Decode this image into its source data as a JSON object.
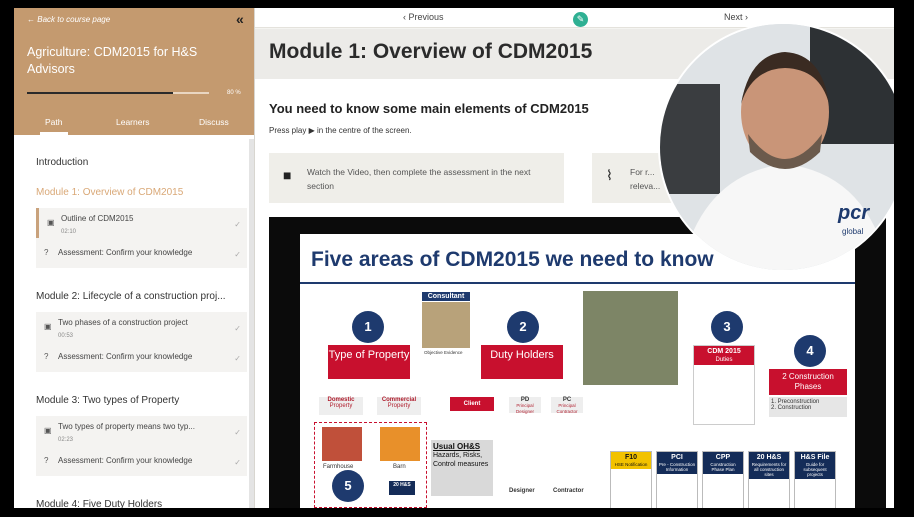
{
  "sidebar": {
    "back_label": "Back to course page",
    "collapse_icon": "double-chevron-left-icon",
    "course_title": "Agriculture: CDM2015 for H&S Advisors",
    "progress_pct": 80,
    "progress_label": "80 %",
    "tabs": [
      "Path",
      "Learners",
      "Discuss"
    ],
    "active_tab": "Path",
    "intro_label": "Introduction",
    "modules": [
      {
        "title": "Module 1: Overview of CDM2015",
        "current": true,
        "lessons": [
          {
            "icon": "video-icon",
            "title": "Outline of CDM2015",
            "duration": "02:10",
            "check": "✓",
            "active": true
          },
          {
            "icon": "question-icon",
            "title": "Assessment: Confirm your knowledge",
            "duration": "",
            "check": "✓",
            "active": false
          }
        ]
      },
      {
        "title": "Module 2: Lifecycle of a construction proj...",
        "current": false,
        "lessons": [
          {
            "icon": "video-icon",
            "title": "Two phases of a construction project",
            "duration": "00:53",
            "check": "✓",
            "active": false
          },
          {
            "icon": "question-icon",
            "title": "Assessment: Confirm your knowledge",
            "duration": "",
            "check": "✓",
            "active": false
          }
        ]
      },
      {
        "title": "Module 3: Two types of Property",
        "current": false,
        "lessons": [
          {
            "icon": "video-icon",
            "title": "Two types of property means two typ...",
            "duration": "02:23",
            "check": "✓",
            "active": false
          },
          {
            "icon": "question-icon",
            "title": "Assessment: Confirm your knowledge",
            "duration": "",
            "check": "✓",
            "active": false
          }
        ]
      },
      {
        "title": "Module 4: Five Duty Holders",
        "current": false,
        "lessons": []
      }
    ]
  },
  "topbar": {
    "prev_label": "‹ Previous",
    "next_label": "Next ›",
    "edit_icon": "pencil-icon"
  },
  "main": {
    "module_title": "Module 1: Overview of CDM2015",
    "subheading": "You need to know some main elements of CDM2015",
    "press_play": "Press play ▶ in the centre of the screen.",
    "cards": [
      {
        "icon": "video-camera-icon",
        "text": "Watch the Video, then complete the assessment in the next section"
      },
      {
        "icon": "paperclip-icon",
        "text": "For r... releva..."
      }
    ]
  },
  "slide": {
    "title": "Five areas of CDM2015 we need to know",
    "numbers": [
      "1",
      "2",
      "3",
      "4",
      "5"
    ],
    "consultant": "Consultant",
    "objective": "Objective Evidence",
    "type_of_property": "Type of Property",
    "duty_holders": "Duty Holders",
    "cdm_box": "CDM 2015",
    "duties": "Duties",
    "construction_phases": "2 Construction Phases",
    "phase_list": [
      "1. Preconstruction",
      "2. Construction"
    ],
    "domestic": "Domestic",
    "commercial": "Commercial",
    "property": "Property",
    "client": "Client",
    "pd": "PD",
    "pd_sub": "Principal Designer",
    "pc": "PC",
    "pc_sub": "Principal Contractor",
    "farmhouse": "Farmhouse",
    "barn": "Barn",
    "usual": "Usual OH&S",
    "hazards": "Hazards, Risks, Control measures",
    "designer": "Designer",
    "contractor": "Contractor",
    "docs": [
      {
        "title": "F10",
        "sub": "HSE Notification"
      },
      {
        "title": "PCI",
        "sub": "Pre - Construction Information"
      },
      {
        "title": "CPP",
        "sub": "Construction Phase Plan"
      },
      {
        "title": "20 H&S",
        "sub": "Requirements for all construction sites"
      },
      {
        "title": "H&S File",
        "sub": "Guide for subsequent projects"
      }
    ],
    "small_doc": "20 H&S"
  },
  "presenter": {
    "logo": "pcr",
    "logo_sub": "global"
  },
  "colors": {
    "sidebar_header": "#c49a6f",
    "accent_current": "#d9a877",
    "navy": "#1e3a6e",
    "red": "#c8102e",
    "edit_green": "#2fb093"
  }
}
